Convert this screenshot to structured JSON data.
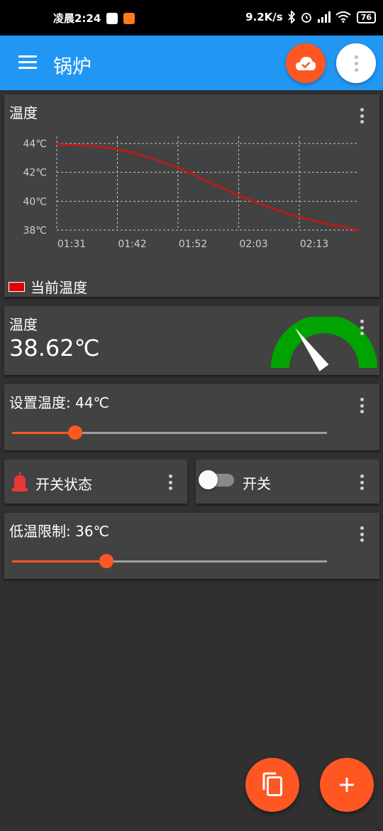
{
  "status_bar": {
    "time": "凌晨2:24",
    "network_speed": "9.2K/s",
    "battery": "76"
  },
  "app_bar": {
    "title": "锅炉",
    "color": "#2196f3"
  },
  "temp_chart_card": {
    "title": "温度",
    "legend": "当前温度"
  },
  "chart_data": {
    "type": "line",
    "x": [
      "01:31",
      "01:42",
      "01:52",
      "02:03",
      "02:13",
      "02:21"
    ],
    "x_ticks": [
      "01:31",
      "01:42",
      "01:52",
      "02:03",
      "02:13"
    ],
    "y_ticks": [
      "44℃",
      "42℃",
      "40℃",
      "38℃"
    ],
    "ylim": [
      38,
      44
    ],
    "grid": true,
    "legend_position": "bottom-left",
    "series": [
      {
        "name": "当前温度",
        "color": "#b71c1c",
        "values": [
          43.95,
          43.6,
          42.3,
          40.4,
          38.9,
          38.0
        ]
      }
    ]
  },
  "temp_gauge_card": {
    "title": "温度",
    "value": "38.62℃",
    "gauge_fraction": 0.3
  },
  "set_temp_card": {
    "title": "设置温度: 44℃",
    "slider_fraction": 0.2
  },
  "switch_status_card": {
    "label": "开关状态",
    "icon": "alarm-light-icon",
    "icon_color": "#e53935"
  },
  "switch_card": {
    "label": "开关",
    "checked": false
  },
  "low_temp_card": {
    "title": "低温限制: 36℃",
    "slider_fraction": 0.3
  },
  "accent_color": "#ff5722"
}
